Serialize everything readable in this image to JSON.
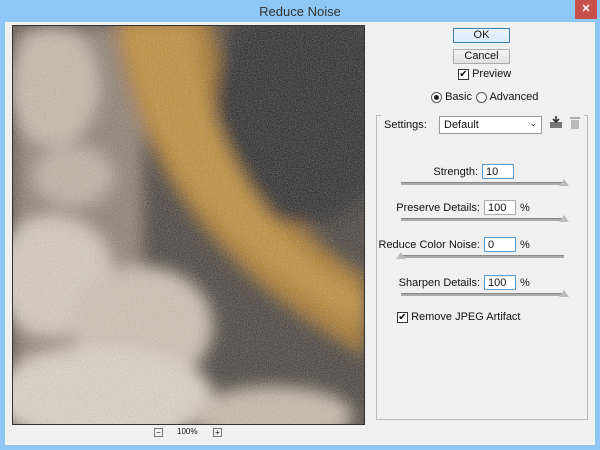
{
  "window": {
    "title": "Reduce Noise",
    "close": "✕"
  },
  "buttons": {
    "ok": "OK",
    "cancel": "Cancel"
  },
  "preview_checkbox": {
    "label": "Preview",
    "checked": true
  },
  "mode": {
    "basic": "Basic",
    "advanced": "Advanced",
    "selected": "Basic"
  },
  "settings": {
    "label": "Settings:",
    "value": "Default",
    "icons": [
      "save-preset-icon",
      "delete-preset-icon"
    ]
  },
  "controls": [
    {
      "label": "Strength:",
      "value": "10",
      "unit": "",
      "slider": 1.0
    },
    {
      "label": "Preserve Details:",
      "value": "100",
      "unit": "%",
      "slider": 1.0
    },
    {
      "label": "Reduce Color Noise:",
      "value": "0",
      "unit": "%",
      "slider": 0.0
    },
    {
      "label": "Sharpen Details:",
      "value": "100",
      "unit": "%",
      "slider": 1.0
    }
  ],
  "jpeg_checkbox": {
    "label": "Remove JPEG Artifact",
    "checked": true
  },
  "zoom": {
    "level": "100%",
    "minus": "−",
    "plus": "+"
  }
}
